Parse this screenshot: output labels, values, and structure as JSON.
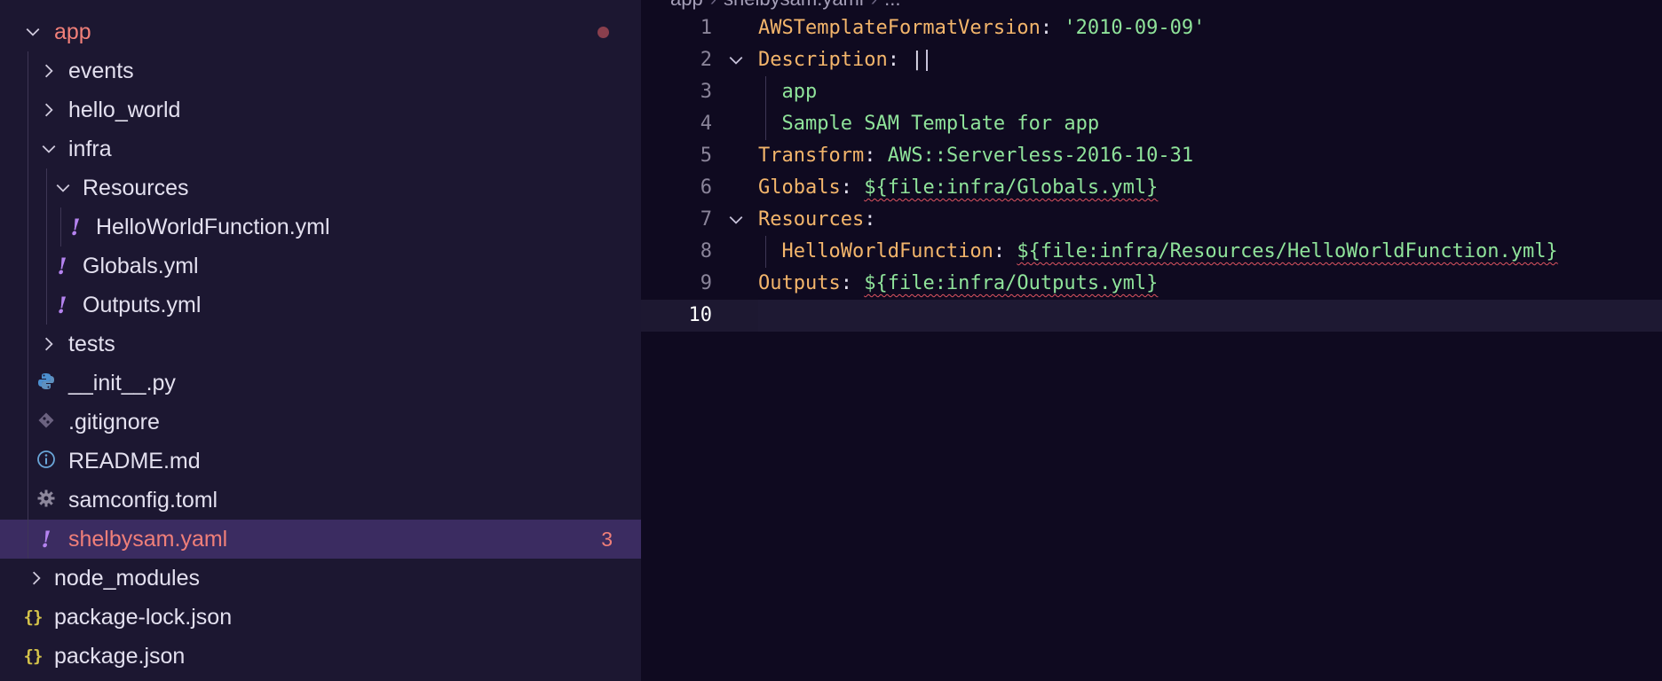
{
  "sidebar": {
    "rows": [
      {
        "label": "app",
        "icon": "none",
        "twisty": "chevron-down",
        "status": "dot",
        "modified": true
      },
      {
        "label": "events",
        "icon": "none",
        "twisty": "chevron-right"
      },
      {
        "label": "hello_world",
        "icon": "none",
        "twisty": "chevron-right"
      },
      {
        "label": "infra",
        "icon": "none",
        "twisty": "chevron-down"
      },
      {
        "label": "Resources",
        "icon": "none",
        "twisty": "chevron-down"
      },
      {
        "label": "HelloWorldFunction.yml",
        "icon": "yaml-icon"
      },
      {
        "label": "Globals.yml",
        "icon": "yaml-icon"
      },
      {
        "label": "Outputs.yml",
        "icon": "yaml-icon"
      },
      {
        "label": "tests",
        "icon": "none",
        "twisty": "chevron-right"
      },
      {
        "label": "__init__.py",
        "icon": "python-icon"
      },
      {
        "label": ".gitignore",
        "icon": "git-icon"
      },
      {
        "label": "README.md",
        "icon": "info-icon"
      },
      {
        "label": "samconfig.toml",
        "icon": "gear-icon"
      },
      {
        "label": "shelbysam.yaml",
        "icon": "yaml-icon",
        "badge": "3",
        "modified": true,
        "selected": true
      },
      {
        "label": "node_modules",
        "icon": "none",
        "twisty": "chevron-right"
      },
      {
        "label": "package-lock.json",
        "icon": "json-icon"
      },
      {
        "label": "package.json",
        "icon": "json-icon"
      }
    ]
  },
  "editor": {
    "breadcrumb": [
      "app",
      "shelbysam.yaml",
      "..."
    ],
    "current_line": 10,
    "lines": [
      {
        "num": "1",
        "tokens": [
          {
            "t": "AWSTemplateFormatVersion",
            "c": "key"
          },
          {
            "t": ": ",
            "c": "punct"
          },
          {
            "t": "'2010-09-09'",
            "c": "str"
          }
        ]
      },
      {
        "num": "2",
        "fold": true,
        "tokens": [
          {
            "t": "Description",
            "c": "key"
          },
          {
            "t": ": |",
            "c": "punct"
          }
        ],
        "cursor": true
      },
      {
        "num": "3",
        "guide": true,
        "tokens": [
          {
            "t": "  app",
            "c": "plain"
          }
        ]
      },
      {
        "num": "4",
        "guide": true,
        "tokens": [
          {
            "t": "  Sample SAM Template for app",
            "c": "plain"
          }
        ]
      },
      {
        "num": "5",
        "tokens": [
          {
            "t": "Transform",
            "c": "key"
          },
          {
            "t": ": ",
            "c": "punct"
          },
          {
            "t": "AWS::Serverless-2016-10-31",
            "c": "plain"
          }
        ]
      },
      {
        "num": "6",
        "tokens": [
          {
            "t": "Globals",
            "c": "key"
          },
          {
            "t": ": ",
            "c": "punct"
          },
          {
            "t": "${file:infra/Globals.yml}",
            "c": "plain",
            "err": true
          }
        ]
      },
      {
        "num": "7",
        "fold": true,
        "tokens": [
          {
            "t": "Resources",
            "c": "key"
          },
          {
            "t": ":",
            "c": "punct"
          }
        ]
      },
      {
        "num": "8",
        "guide": true,
        "tokens": [
          {
            "t": "  HelloWorldFunction",
            "c": "key"
          },
          {
            "t": ": ",
            "c": "punct"
          },
          {
            "t": "${file:infra/Resources/HelloWorldFunction.yml}",
            "c": "plain",
            "err": true
          }
        ]
      },
      {
        "num": "9",
        "tokens": [
          {
            "t": "Outputs",
            "c": "key"
          },
          {
            "t": ": ",
            "c": "punct"
          },
          {
            "t": "${file:infra/Outputs.yml}",
            "c": "plain",
            "err": true
          }
        ]
      },
      {
        "num": "10",
        "tokens": []
      }
    ]
  },
  "colors": {
    "sidebar_bg": "#1c1731",
    "editor_bg": "#0f0a20",
    "selected_row": "#3b2c61",
    "modified_text": "#f07f79",
    "yaml_key": "#f3b56b",
    "yaml_value": "#8fe39a",
    "yaml_icon": "#b583f0",
    "error_squiggle": "#e05561"
  }
}
